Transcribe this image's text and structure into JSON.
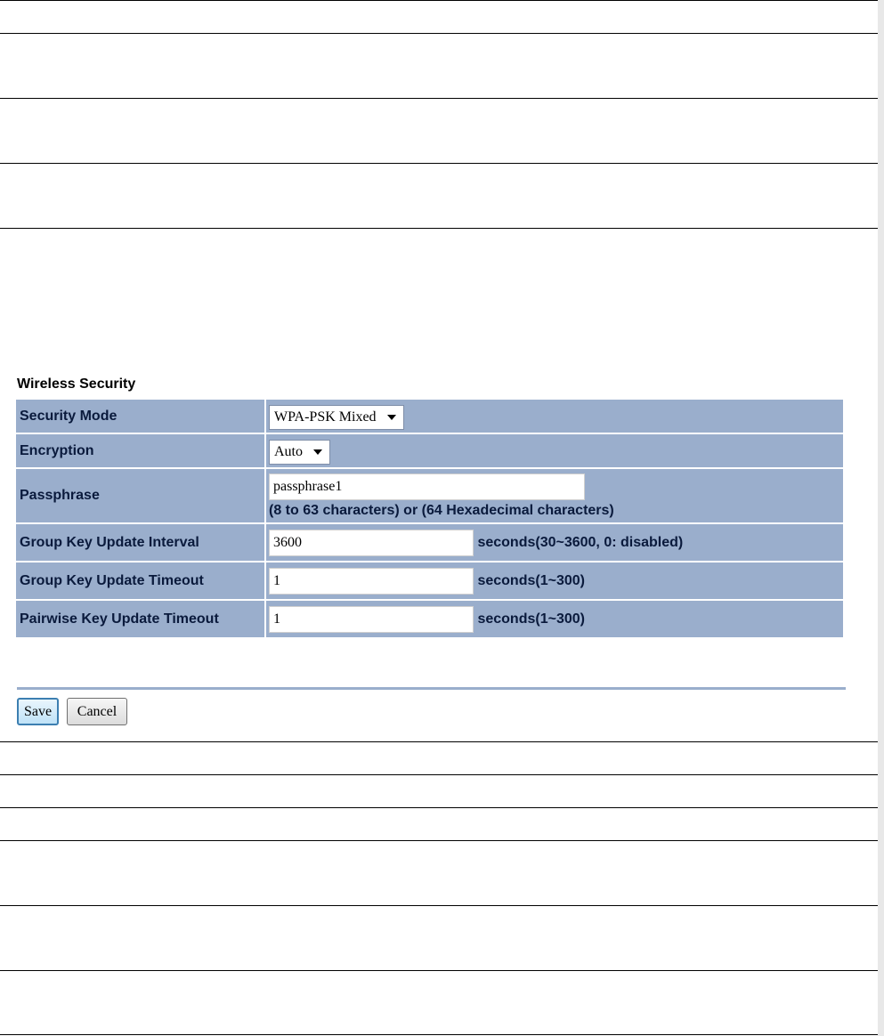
{
  "section_title": "Wireless Security",
  "fields": {
    "security_mode": {
      "label": "Security Mode",
      "selected": "WPA-PSK Mixed"
    },
    "encryption": {
      "label": "Encryption",
      "selected": "Auto"
    },
    "passphrase": {
      "label": "Passphrase",
      "value": "passphrase1",
      "hint": "(8 to 63 characters) or (64 Hexadecimal characters)"
    },
    "group_key_update_interval": {
      "label": "Group Key Update Interval",
      "value": "3600",
      "hint": "seconds(30~3600, 0: disabled)"
    },
    "group_key_update_timeout": {
      "label": "Group Key Update Timeout",
      "value": "1",
      "hint": "seconds(1~300)"
    },
    "pairwise_key_update_timeout": {
      "label": "Pairwise Key Update Timeout",
      "value": "1",
      "hint": "seconds(1~300)"
    }
  },
  "buttons": {
    "save": "Save",
    "cancel": "Cancel"
  },
  "colors": {
    "row_background": "#9aaecc",
    "label_text": "#0a1a3c",
    "save_border": "#3c7fb1"
  }
}
